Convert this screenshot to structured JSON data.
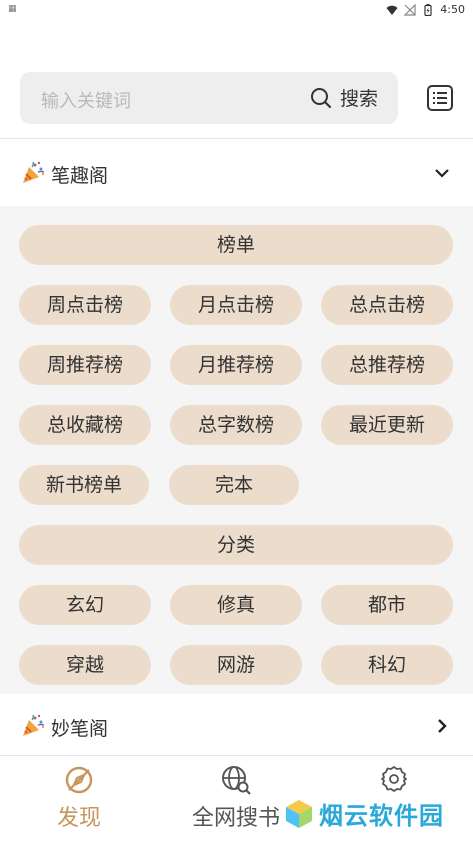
{
  "status": {
    "time": "4:50",
    "left_glyph": "▦"
  },
  "search": {
    "placeholder": "输入关键词",
    "button_label": "搜索"
  },
  "sections": [
    {
      "title": "笔趣阁",
      "expanded": true
    },
    {
      "title": "妙笔阁",
      "expanded": false
    }
  ],
  "panel": {
    "header1": "榜单",
    "rank_items": [
      "周点击榜",
      "月点击榜",
      "总点击榜",
      "周推荐榜",
      "月推荐榜",
      "总推荐榜",
      "总收藏榜",
      "总字数榜",
      "最近更新",
      "新书榜单",
      "完本"
    ],
    "header2": "分类",
    "category_items": [
      "玄幻",
      "修真",
      "都市",
      "穿越",
      "网游",
      "科幻"
    ]
  },
  "nav": {
    "discover": "发现",
    "search_all": "全网搜书",
    "settings_label": ""
  },
  "watermark": "烟云软件园",
  "colors": {
    "accent": "#c7965a",
    "pill": "#ecdccb",
    "panel_bg": "#f5f5f5"
  }
}
